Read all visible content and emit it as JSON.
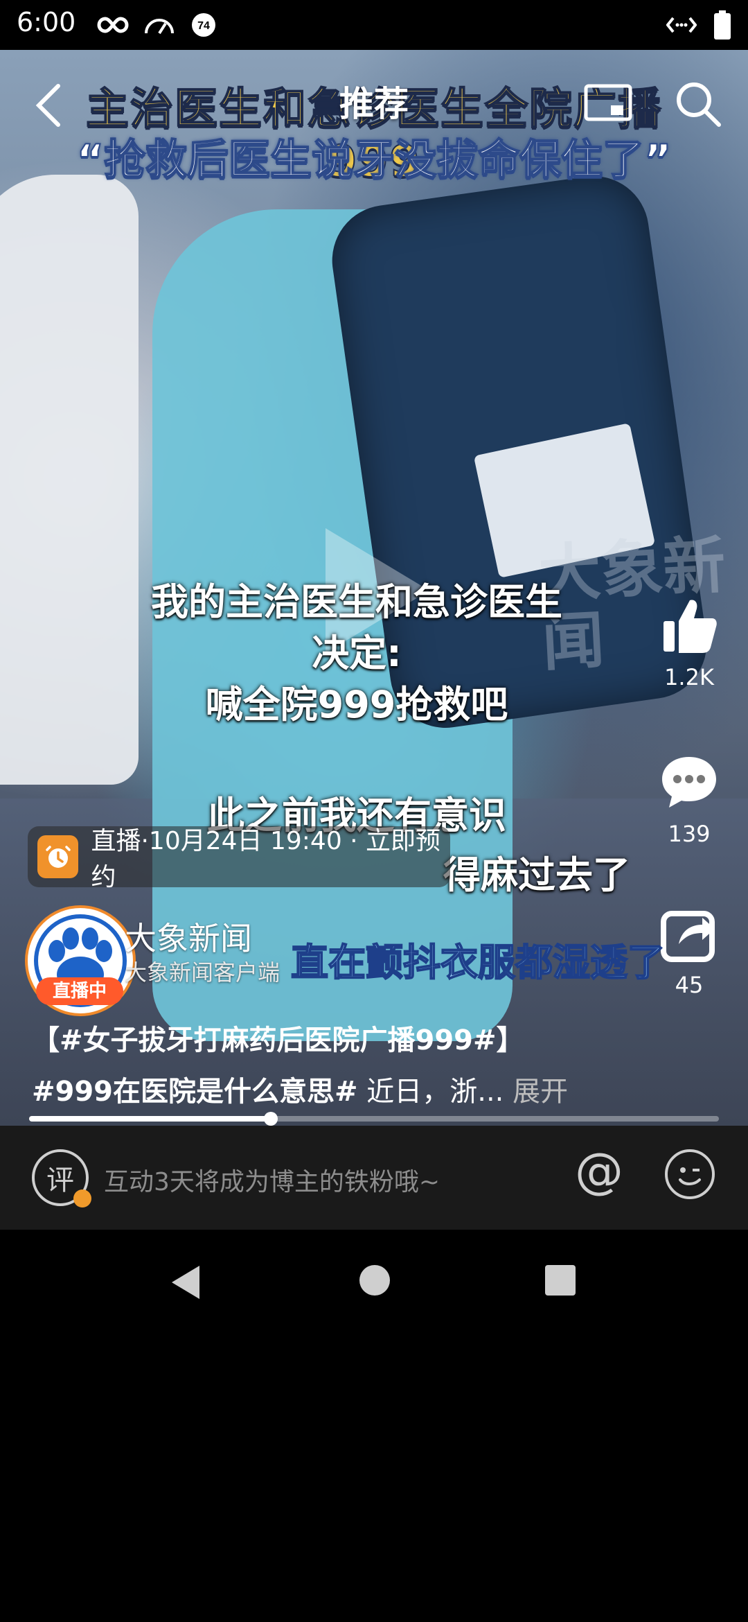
{
  "status_bar": {
    "time": "6:00",
    "signal_badge": "74",
    "icons": [
      "infinity-icon",
      "speedometer-icon",
      "badge-74-icon",
      "code-icon",
      "battery-icon"
    ]
  },
  "header": {
    "title": "推荐",
    "icons": [
      "back-icon",
      "screen-cast-icon",
      "search-icon"
    ]
  },
  "video_overlay": {
    "headline_1": "主治医生和急诊医生全院广播999",
    "headline_2": "“抢救后医生说牙没拔命保住了”",
    "subtitle_lines": [
      "我的主治医生和急诊医生",
      "决定:",
      "喊全院999抢救吧",
      "此之前我还有意识"
    ],
    "subtitle_partial": "得麻过去了",
    "subtitle_blue": "直在颤抖衣服都湿透了",
    "watermark": "大象新闻"
  },
  "live_reminder": {
    "text": "直播·10月24日 19:40 · 立即预约"
  },
  "author": {
    "name": "大象新闻",
    "subtitle": "大象新闻客户端",
    "live_badge": "直播中"
  },
  "description": {
    "line1": "【#女子拔牙打麻药后医院广播999#】",
    "hashtag": "#999在医院是什么意思#",
    "text": " 近日，浙...",
    "more": " 展开"
  },
  "actions": {
    "likes": "1.2K",
    "comments": "139",
    "shares": "45"
  },
  "progress": {
    "fraction": 0.35
  },
  "comment_bar": {
    "icon_label": "评",
    "placeholder": "互动3天将成为博主的铁粉哦~",
    "at_symbol": "@"
  },
  "colors": {
    "accent_orange": "#f08a2b",
    "live_red": "#ff5a2b",
    "headline_yellow": "#f0c94a"
  }
}
